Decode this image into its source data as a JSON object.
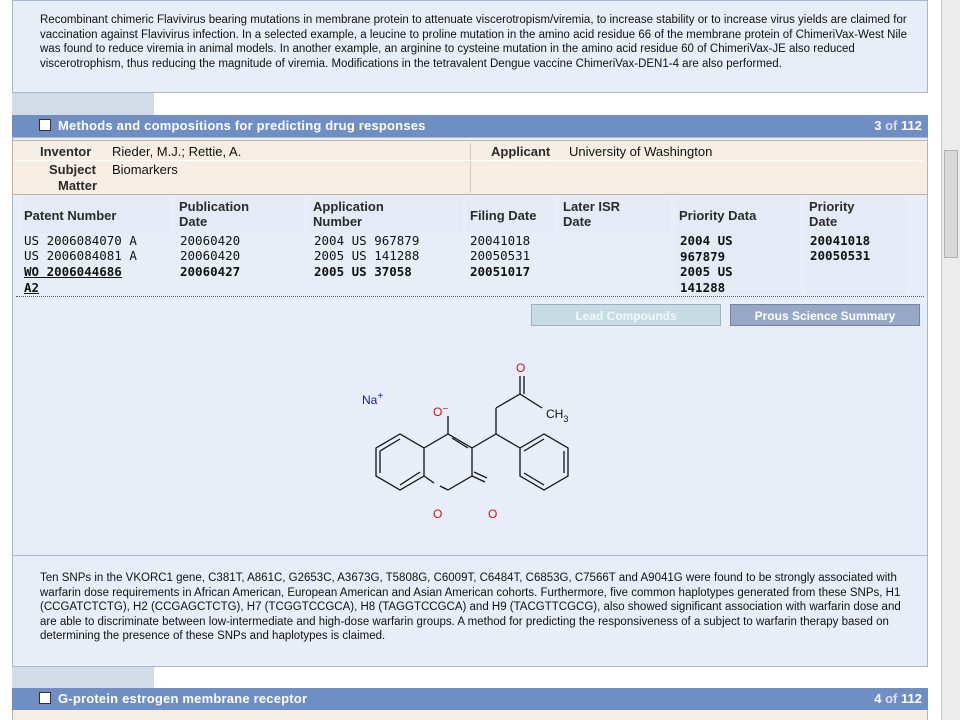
{
  "abstract_top": "Recombinant chimeric Flavivirus bearing mutations in membrane protein to attenuate viscerotropism/viremia, to increase stability or to increase virus yields are claimed for vaccination against Flavivirus infection. In a selected example, a leucine to proline mutation in the amino acid residue 66 of the membrane protein of ChimeriVax-West Nile was found to reduce viremia in animal models. In another example, an arginine to cysteine mutation in the amino acid residue 60 of ChimeriVax-JE also reduced viscerotrophism, thus reducing the magnitude of viremia. Modifications in the tetravalent Dengue vaccine ChimeriVax-DEN1-4 are also performed.",
  "record": {
    "title": "Methods and compositions for predicting drug responses",
    "index": "3",
    "of_label": "of",
    "total": "112",
    "inventor_label": "Inventor",
    "inventor": "Rieder, M.J.; Rettie, A.",
    "applicant_label": "Applicant",
    "applicant": "University of Washington",
    "subject_label_1": "Subject",
    "subject_label_2": "Matter",
    "subject": "Biomarkers",
    "columns": {
      "patent_number": "Patent Number",
      "publication_date_1": "Publication",
      "publication_date_2": "Date",
      "application_number_1": "Application",
      "application_number_2": "Number",
      "filing_date": "Filing Date",
      "later_isr_1": "Later ISR",
      "later_isr_2": "Date",
      "priority_data": "Priority Data",
      "priority_date_1": "Priority",
      "priority_date_2": "Date"
    },
    "patents": [
      {
        "number": "US 2006084070 A",
        "pub_date": "20060420",
        "app_number": "2004 US 967879",
        "filing_date": "20041018"
      },
      {
        "number": "US 2006084081 A",
        "pub_date": "20060420",
        "app_number": "2005 US 141288",
        "filing_date": "20050531"
      },
      {
        "number_1": "WO 2006044686",
        "number_2": "A2",
        "pub_date": "20060427",
        "app_number": "2005 US 37058",
        "filing_date": "20051017"
      }
    ],
    "priorities": [
      {
        "data_1": "2004 US",
        "data_2": "967879",
        "date": "20041018"
      },
      {
        "data_1": "2005 US",
        "data_2": "141288",
        "date": "20050531"
      }
    ],
    "buttons": {
      "lead_compounds": "Lead Compounds",
      "prous_summary": "Prous Science Summary"
    },
    "structure_labels": {
      "na": "Na",
      "na_charge": "+",
      "o_minus": "O",
      "o_charge": "−",
      "o_ketone": "O",
      "ch3": "CH",
      "ch3_sub": "3",
      "o_ring": "O",
      "o_carbonyl": "O"
    },
    "abstract": "Ten SNPs in the VKORC1 gene, C381T, A861C, G2653C, A3673G, T5808G, C6009T, C6484T, C6853G, C7566T and A9041G were found to be strongly associated with warfarin dose requirements in African American, European American and Asian American cohorts. Furthermore, five common haplotypes generated from these SNPs, H1 (CCGATCTCTG), H2 (CCGAGCTCTG), H7 (TCGGTCCGCA), H8 (TAGGTCCGCA) and H9 (TACGTTCGCG), also showed significant association with warfarin dose and are able to discriminate between low-intermediate and high-dose warfarin groups. A method for predicting the responsiveness of a subject to warfarin therapy based on determining the presence of these SNPs and haplotypes is claimed."
  },
  "next_record": {
    "title": "G-protein estrogen membrane receptor",
    "index": "4",
    "of_label": "of",
    "total": "112"
  },
  "colors": {
    "header_blue": "#6f8ec3",
    "panel_bg": "#e8eef8",
    "meta_bg": "#f6eee4",
    "structure_red": "#cc1111",
    "structure_blue": "#1a1aa8"
  }
}
